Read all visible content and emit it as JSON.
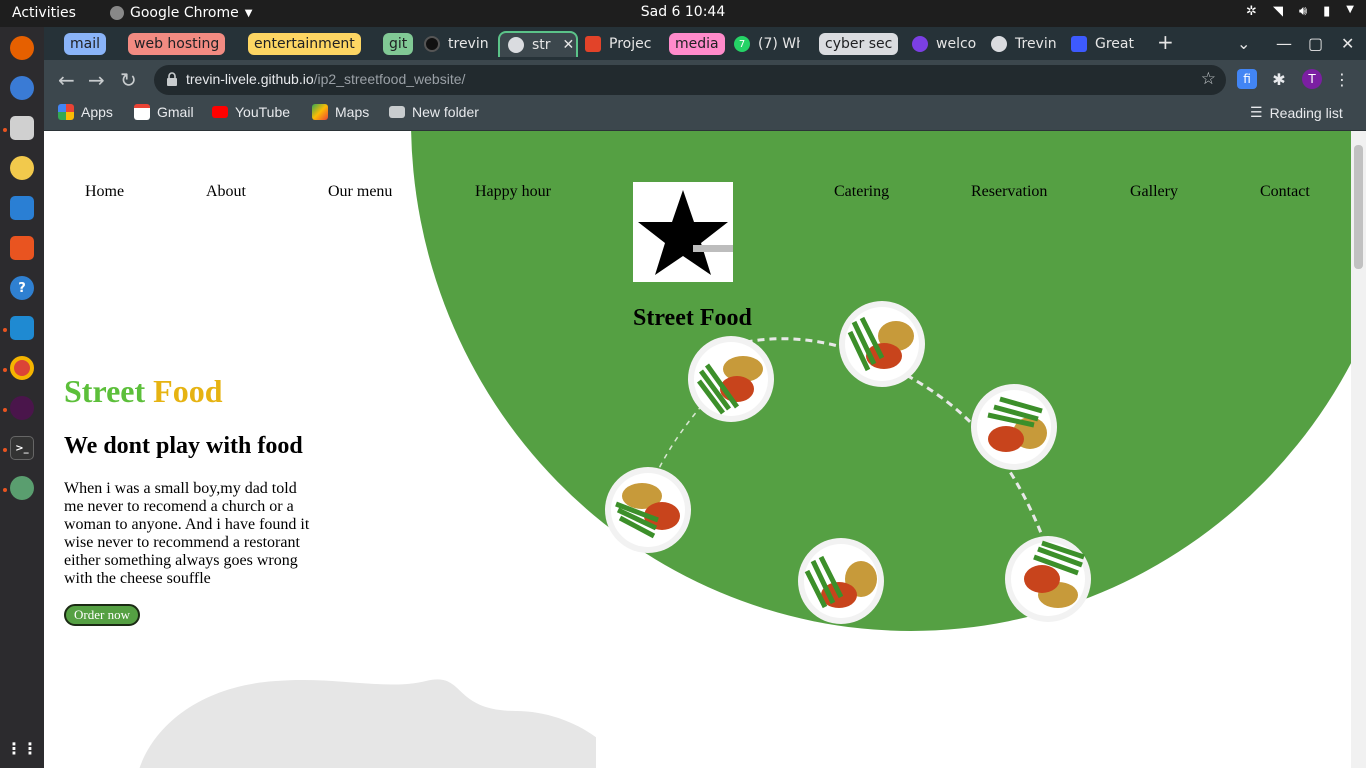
{
  "system": {
    "activities": "Activities",
    "app_name": "Google Chrome",
    "clock": "Sad 6  10:44"
  },
  "tabs": {
    "groups": [
      {
        "label": "mail",
        "color": "#8ab4f8"
      },
      {
        "label": "web hosting",
        "color": "#f28b82"
      },
      {
        "label": "entertainment",
        "color": "#fdd663"
      },
      {
        "label": "git",
        "color": "#81c995"
      },
      {
        "label": "media",
        "color": "#ff8bcb"
      },
      {
        "label": "cyber sec",
        "color": "#dadce0"
      }
    ],
    "items": [
      {
        "label": "trevin"
      },
      {
        "label": "str"
      },
      {
        "label": "Projec"
      },
      {
        "label": "(7) Wh"
      },
      {
        "label": "welco"
      },
      {
        "label": "Trevin"
      },
      {
        "label": "Great"
      }
    ],
    "new_tab": "+"
  },
  "toolbar": {
    "url_host": "trevin-livele.github.io",
    "url_path": "/ip2_streetfood_website/",
    "profile_initial": "T"
  },
  "bookmarks": {
    "items": [
      {
        "label": "Apps"
      },
      {
        "label": "Gmail"
      },
      {
        "label": "YouTube"
      },
      {
        "label": "Maps"
      },
      {
        "label": "New folder"
      }
    ],
    "reading_list": "Reading list"
  },
  "site": {
    "nav": [
      "Home",
      "About",
      "Our menu",
      "Happy hour",
      "Catering",
      "Reservation",
      "Gallery",
      "Contact"
    ],
    "logo_title": "Street Food",
    "hero_title_1": "Street",
    "hero_title_2": "Food",
    "hero_subtitle": "We dont play with food",
    "hero_text": "When i was a small boy,my dad told me never to recomend a church or a woman to anyone. And i have found it wise never to recommend a restorant either something always goes wrong with the cheese souffle",
    "order_button": "Order now",
    "colors": {
      "green": "#55a043",
      "title_green": "#5cbf3a",
      "title_gold": "#e6b312"
    }
  }
}
